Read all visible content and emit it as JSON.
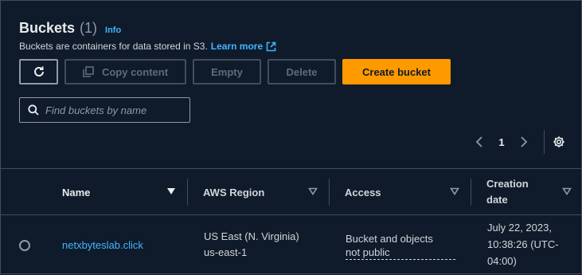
{
  "header": {
    "title": "Buckets",
    "count": "(1)",
    "info": "Info",
    "description": "Buckets are containers for data stored in S3.",
    "learn_more": "Learn more"
  },
  "toolbar": {
    "refresh_icon": "refresh-icon",
    "copy_label": "Copy content",
    "empty_label": "Empty",
    "delete_label": "Delete",
    "create_label": "Create bucket"
  },
  "search": {
    "placeholder": "Find buckets by name"
  },
  "pagination": {
    "current_page": "1"
  },
  "table": {
    "columns": [
      "Name",
      "AWS Region",
      "Access",
      "Creation date"
    ],
    "rows": [
      {
        "name": "netxbyteslab.click",
        "region_name": "US East (N. Virginia)",
        "region_code": "us-east-1",
        "access_line1": "Bucket and objects",
        "access_line2": "not public",
        "created_line1": "July 22, 2023,",
        "created_line2": "10:38:26 (UTC-",
        "created_line3": "04:00)"
      }
    ]
  },
  "colors": {
    "background": "#0f1b2a",
    "accent": "#ff9900",
    "link": "#42b4ff",
    "border": "#414d5c"
  }
}
